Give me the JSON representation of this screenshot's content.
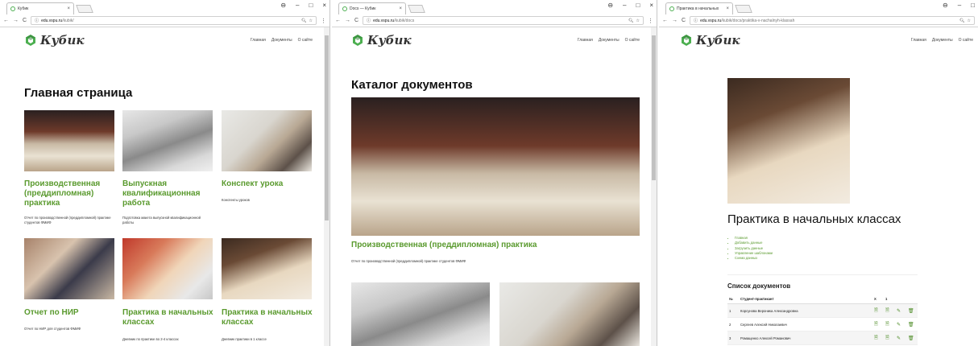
{
  "windows": [
    {
      "tab_title": "Кубик",
      "url_domain": "edu.vspu.ru",
      "url_path": "/kubik/",
      "logo_text": "Кубик",
      "nav": [
        "Главная",
        "Документы",
        "О сайте"
      ],
      "heading": "Главная страница",
      "cards": [
        {
          "title": "Производственная (преддипломная) практика",
          "desc": "Отчет по производственной (преддипломной) практике студентов ФМИФ"
        },
        {
          "title": "Выпускная квалификационная работа",
          "desc": "Подготовка макета выпускной квалификационной работы"
        },
        {
          "title": "Конспект урока",
          "desc": "Конспекты уроков"
        },
        {
          "title": "Отчет по НИР",
          "desc": "Отчет по НИР для студентов ФМИФ"
        },
        {
          "title": "Практика в начальных классах",
          "desc": "Дневник по практике во 2-4 классах"
        },
        {
          "title": "Практика в начальных классах",
          "desc": "Дневник практики в 1 классе"
        }
      ]
    },
    {
      "tab_title": "Docs — Кубик",
      "url_domain": "edu.vspu.ru",
      "url_path": "/kubik/docs",
      "logo_text": "Кубик",
      "nav": [
        "Главная",
        "Документы",
        "О сайте"
      ],
      "heading": "Каталог документов",
      "featured_title": "Производственная (преддипломная) практика",
      "featured_desc": "Отчет по производственной (преддипломной) практике студентов ФМИФ"
    },
    {
      "tab_title": "Практика в начальных",
      "url_domain": "edu.vspu.ru",
      "url_path": "/kubik/docs/praktika-v-nachalnyh-klassah",
      "logo_text": "Кубик",
      "nav": [
        "Главная",
        "Документы",
        "О сайте"
      ],
      "heading": "Практика в начальных классах",
      "links": [
        "Главная",
        "Добавить данные",
        "Загрузить данные",
        "Управление шаблонами",
        "Схема данных"
      ],
      "list_title": "Список документов",
      "table": {
        "headers": [
          "№",
          "Студент-практикант",
          "X",
          "1"
        ],
        "rows": [
          {
            "n": "1",
            "name": "Корсунова Вероника Александровна"
          },
          {
            "n": "2",
            "name": "Сергеев Алексей Николаевич"
          },
          {
            "n": "3",
            "name": "Ромащенко Алексей Романович"
          }
        ]
      }
    }
  ],
  "colors": {
    "accent": "#5a9a2e",
    "logo_green": "#4caf50"
  }
}
